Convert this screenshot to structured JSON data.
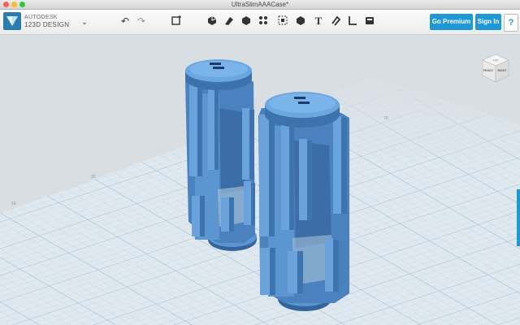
{
  "window": {
    "title": "UltraSlimAAACase*"
  },
  "app": {
    "brand_line1": "AUTODESK",
    "brand_line2": "123D DESIGN"
  },
  "toolbar": {
    "icons": [
      "undo-icon",
      "redo-icon",
      "primitives-icon",
      "sketch-icon",
      "construct-icon",
      "modify-icon",
      "pattern-icon",
      "group-icon",
      "combine-icon",
      "text-icon",
      "snap-icon",
      "measure-icon",
      "material-icon"
    ],
    "go_premium_label": "Go Premium",
    "sign_in_label": "Sign In",
    "help_label": "?"
  },
  "viewport": {
    "grid_labels": [
      "50",
      "25",
      "75"
    ],
    "view_cube": {
      "front_label": "FRONT",
      "right_label": "RIGHT",
      "top_label": "TOP"
    }
  },
  "colors": {
    "accent": "#1f98d6",
    "model": "#4d86c4",
    "grid_bg": "#d9dee3",
    "grid_line": "#a9c4d6"
  }
}
